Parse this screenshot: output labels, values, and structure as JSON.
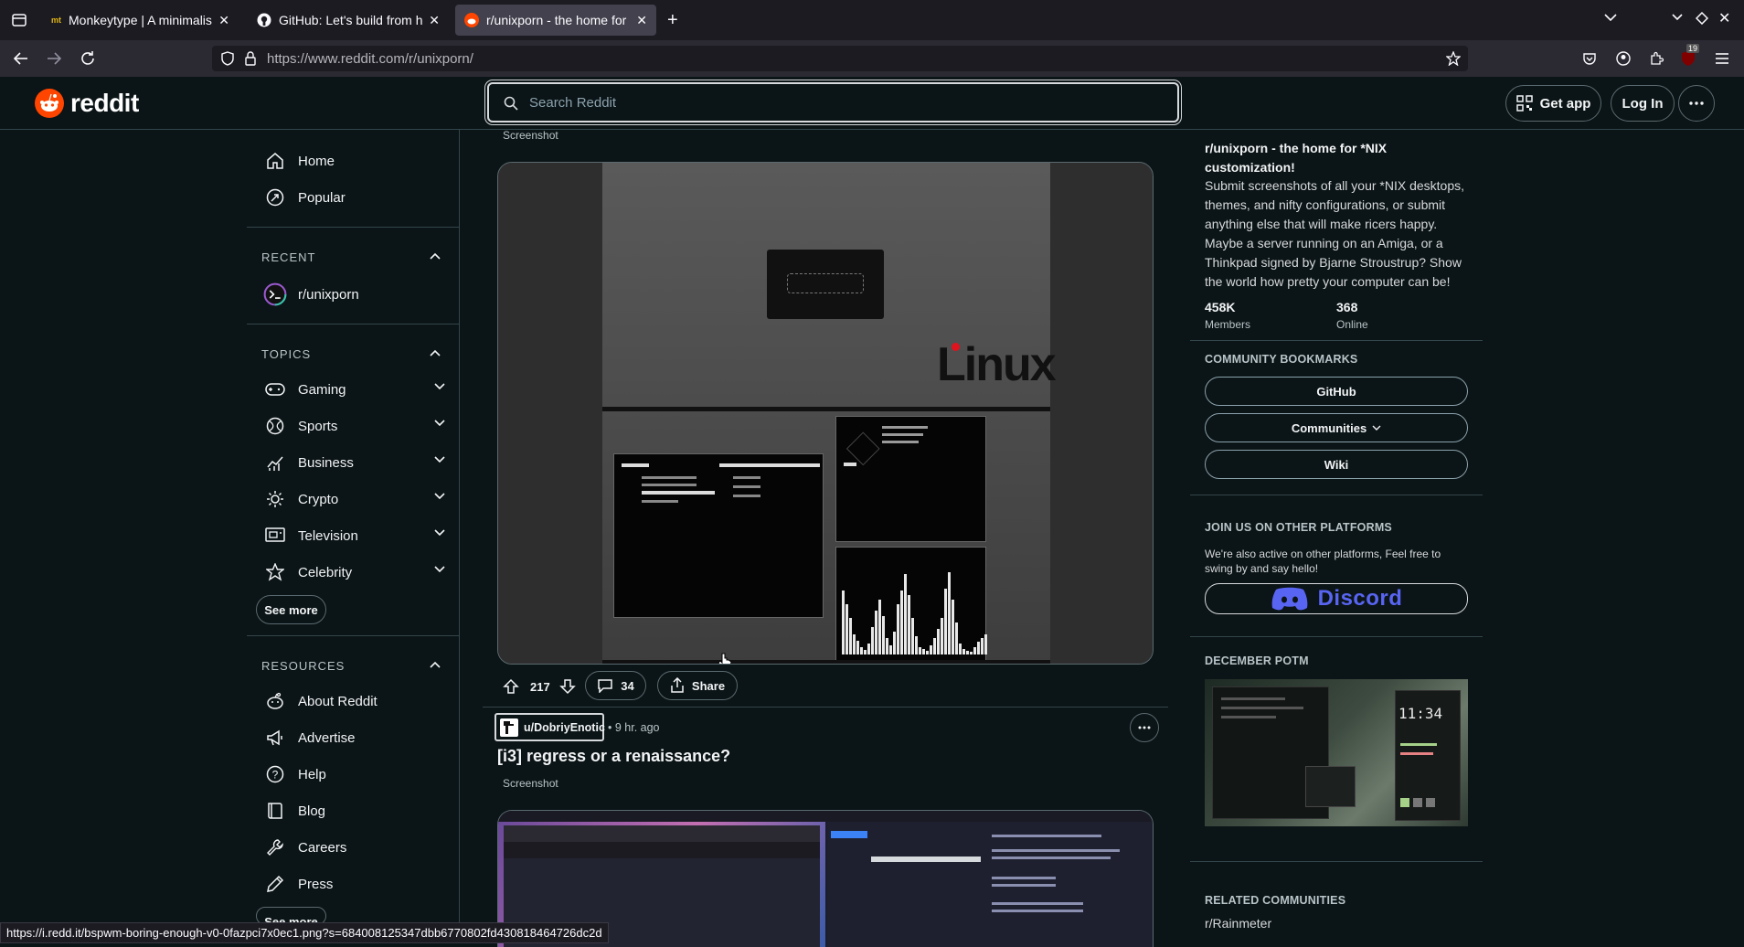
{
  "browser": {
    "tabs": [
      {
        "title": "Monkeytype | A minimalis",
        "favicon": "mt"
      },
      {
        "title": "GitHub: Let's build from he",
        "favicon": "github-icon"
      },
      {
        "title": "r/unixporn - the home for",
        "favicon": "reddit-icon",
        "active": true
      }
    ],
    "url": "https://www.reddit.com/r/unixporn/",
    "notification_count": "19",
    "status_url": "https://i.redd.it/bspwm-boring-enough-v0-0fazpci7x0ec1.png?s=684008125347dbb6770802fd430818464726dc2d"
  },
  "header": {
    "logo_text": "reddit",
    "search_placeholder": "Search Reddit",
    "get_app": "Get app",
    "login": "Log In"
  },
  "sidebar": {
    "home": "Home",
    "popular": "Popular",
    "recent_label": "RECENT",
    "recent_items": [
      "r/unixporn"
    ],
    "topics_label": "TOPICS",
    "topics": [
      "Gaming",
      "Sports",
      "Business",
      "Crypto",
      "Television",
      "Celebrity"
    ],
    "see_more": "See more",
    "resources_label": "RESOURCES",
    "resources": [
      "About Reddit",
      "Advertise",
      "Help",
      "Blog",
      "Careers",
      "Press"
    ]
  },
  "posts": [
    {
      "flair": "Screenshot",
      "votes": "217",
      "comments": "34",
      "share": "Share",
      "image_text": "Linux"
    },
    {
      "author": "u/DobriyEnotic",
      "time": "• 9 hr. ago",
      "title": "[i3] regress or a renaissance?",
      "flair": "Screenshot"
    }
  ],
  "about": {
    "title": "r/unixporn - the home for *NIX customization!",
    "description": "Submit screenshots of all your *NIX desktops, themes, and nifty configurations, or submit anything else that will make ricers happy. Maybe a server running on an Amiga, or a Thinkpad signed by Bjarne Stroustrup? Show the world how pretty your computer can be!",
    "members_value": "458K",
    "members_label": "Members",
    "online_value": "368",
    "online_label": "Online"
  },
  "bookmarks": {
    "title": "COMMUNITY BOOKMARKS",
    "items": [
      "GitHub",
      "Communities",
      "Wiki"
    ]
  },
  "platforms": {
    "title": "JOIN US ON OTHER PLATFORMS",
    "text": "We're also active on other platforms, Feel free to swing by and say hello!",
    "discord": "Discord"
  },
  "potm": {
    "title": "DECEMBER POTM",
    "clock": "11:34"
  },
  "related": {
    "title": "RELATED COMMUNITIES",
    "first": "r/Rainmeter"
  },
  "colors": {
    "reddit_orange": "#ff4500",
    "page_bg": "#0b1416",
    "discord_blurple": "#5865f2"
  }
}
